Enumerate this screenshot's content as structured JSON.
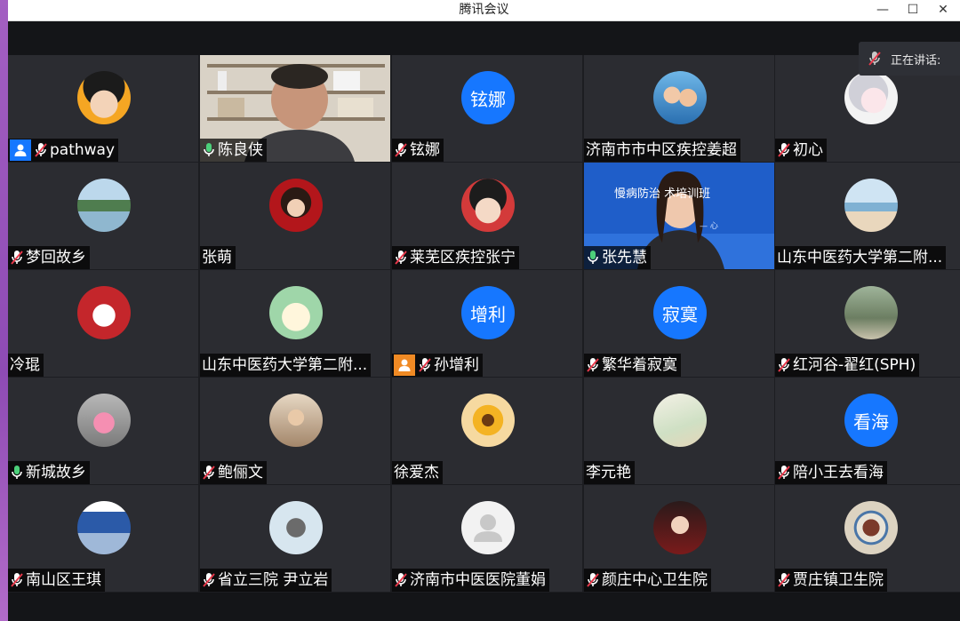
{
  "window": {
    "title": "腾讯会议",
    "controls": {
      "minimize": "—",
      "maximize": "☐",
      "close": "✕"
    }
  },
  "speaking": {
    "label": "正在讲话: ",
    "mic": "muted"
  },
  "colors": {
    "accent": "#1677ff",
    "host_blue": "#1677ff",
    "cohost_orange": "#f08a24",
    "active": "#31c36c",
    "mic_red": "#e8394b"
  },
  "participants": [
    {
      "name": "pathway",
      "mic": "muted",
      "role": "host",
      "avatar": "cartoon-girl-red-bow"
    },
    {
      "name": "陈良侠",
      "mic": "on",
      "video": true,
      "avatar": "video-man-bookshelf"
    },
    {
      "name": "铉娜",
      "mic": "muted",
      "avatar_text": "铉娜"
    },
    {
      "name": "济南市市中区疾控姜超",
      "mic": "none",
      "avatar": "kids-photo"
    },
    {
      "name": "初心",
      "mic": "muted",
      "avatar": "anime-character"
    },
    {
      "name": "梦回故乡",
      "mic": "muted",
      "avatar": "lake-house"
    },
    {
      "name": "张萌",
      "mic": "none",
      "avatar": "new-year-girl"
    },
    {
      "name": "莱芜区疾控张宁",
      "mic": "muted",
      "avatar": "child-red-bow"
    },
    {
      "name": "张先慧",
      "mic": "on",
      "video": true,
      "active": true,
      "avatar": "video-woman-banner",
      "video_text": "慢病防治 术培训班",
      "video_subtext": "— 心"
    },
    {
      "name": "山东中医药大学第二附...",
      "mic": "none",
      "avatar": "beach-girl"
    },
    {
      "name": "冷琨",
      "mic": "none",
      "avatar": "red-cat"
    },
    {
      "name": "山东中医药大学第二附...",
      "mic": "none",
      "avatar": "cartoon-cat"
    },
    {
      "name": "孙增利",
      "mic": "muted",
      "role": "cohost",
      "avatar_text": "增利"
    },
    {
      "name": "繁华着寂寞",
      "mic": "muted",
      "avatar_text": "寂寞"
    },
    {
      "name": "红河谷-翟红(SPH)",
      "mic": "muted",
      "avatar": "banyan-tree"
    },
    {
      "name": "新城故乡",
      "mic": "on",
      "avatar": "toddler-pink"
    },
    {
      "name": "鲍俪文",
      "mic": "muted",
      "avatar": "woman-hat"
    },
    {
      "name": "徐爱杰",
      "mic": "none",
      "avatar": "sunflower"
    },
    {
      "name": "李元艳",
      "mic": "none",
      "avatar": "garden-sketch"
    },
    {
      "name": "陪小王去看海",
      "mic": "muted",
      "avatar_text": "看海"
    },
    {
      "name": "南山区王琪",
      "mic": "muted",
      "avatar": "statue-blue"
    },
    {
      "name": "省立三院  尹立岩",
      "mic": "muted",
      "avatar": "couple-photo"
    },
    {
      "name": "济南市中医医院董娟",
      "mic": "muted",
      "avatar": "default-person"
    },
    {
      "name": "颜庄中心卫生院",
      "mic": "muted",
      "avatar": "woman-red"
    },
    {
      "name": "贾庄镇卫生院",
      "mic": "muted",
      "avatar": "porcelain-bowl"
    }
  ]
}
